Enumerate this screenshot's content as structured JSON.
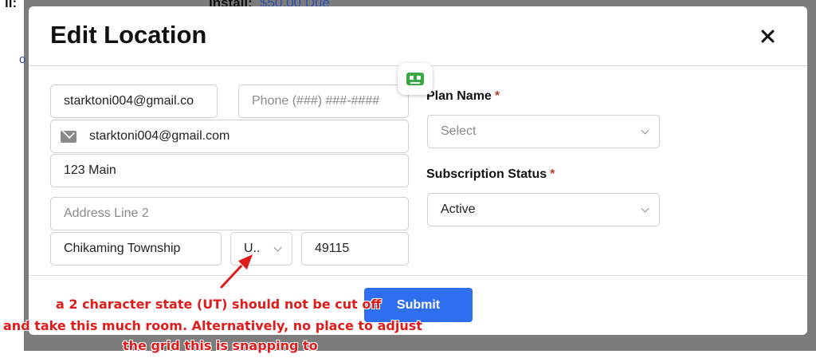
{
  "background": {
    "label_left": "ll:",
    "install_label": "Install:",
    "due_amount": "$50.00 Due",
    "left_link_char": "o"
  },
  "modal": {
    "title": "Edit Location",
    "email_value": "starktoni004@gmail.co",
    "phone_placeholder": "Phone (###) ###-####",
    "email_display": "starktoni004@gmail.com",
    "address_line1": "123 Main",
    "address_line2_placeholder": "Address Line 2",
    "city": "Chikaming Township",
    "state": "U..",
    "zip": "49115",
    "plan_name_label": "Plan Name",
    "plan_name_value": "Select",
    "subscription_status_label": "Subscription Status",
    "subscription_status_value": "Active",
    "required_marker": "*",
    "submit_label": "Submit"
  },
  "annotation": {
    "line1": "a 2 character state (UT) should not be cut off",
    "line2": "and take this much room.   Alternatively, no place to adjust",
    "line3": "the grid this is snapping to"
  },
  "colors": {
    "accent": "#2f6fef",
    "required": "#c0392b",
    "annotation": "#e01b1b",
    "bot": "#3aa845"
  }
}
